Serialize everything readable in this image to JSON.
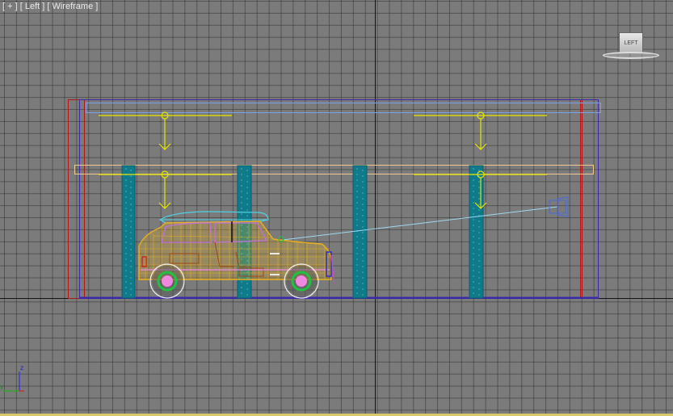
{
  "viewport": {
    "label_plus": "[ + ]",
    "label_view": "[ Left ]",
    "label_shading": "[ Wireframe ]",
    "view_name": "Left",
    "colors": {
      "background": "#7b7b7b",
      "grid": "#333333",
      "world_axis": "#1a1a1a",
      "pillar": "#0e7a8a",
      "light": "#e6e600",
      "frame_purple": "#3a2aa8",
      "frame_red": "#b01818",
      "beam_blue": "#7aa0e8",
      "beam_tan": "#f0c890",
      "car_body": "#e8b020",
      "car_roof": "#50d0e0",
      "wheel_green": "#20c040",
      "wheel_hub": "#f088e0",
      "camera_line": "#a0d8f0"
    }
  },
  "viewcube": {
    "face_label": "LEFT"
  },
  "axis": {
    "z_label": "z",
    "y_label": "y"
  }
}
